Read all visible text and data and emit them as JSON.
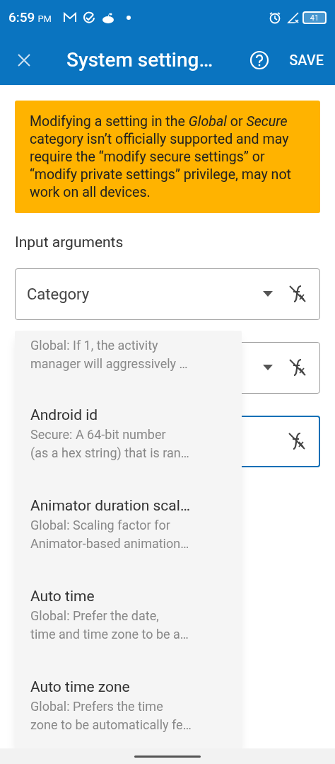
{
  "status_bar": {
    "time": "6:59",
    "meridiem": "PM",
    "battery": "41"
  },
  "toolbar": {
    "title": "System setting…",
    "save": "SAVE"
  },
  "warning": "Modifying a setting in the *Global* or *Secure* category isn’t officially supported and may require the “modify secure settings” or “modify private settings” privilege, may not work on all devices.",
  "section_title": "Input arguments",
  "fields": [
    {
      "label": "Category",
      "focused": false,
      "kind": "dropdown"
    },
    {
      "focused": false,
      "kind": "dropdown"
    },
    {
      "focused": true,
      "kind": "text"
    }
  ],
  "dropdown_menu": [
    {
      "description": "Global: If 1, the activity\nmanager will aggressively …"
    },
    {
      "title": "Android id",
      "description": "Secure: A 64-bit number\n(as a hex string) that is ran…"
    },
    {
      "title": "Animator duration scal…",
      "description": "Global: Scaling factor for\nAnimator-based animation…"
    },
    {
      "title": "Auto time",
      "description": "Global: Prefer the date,\ntime and time zone to be a…"
    },
    {
      "title": "Auto time zone",
      "description": "Global: Prefers the time\nzone to be automatically fe…"
    }
  ]
}
